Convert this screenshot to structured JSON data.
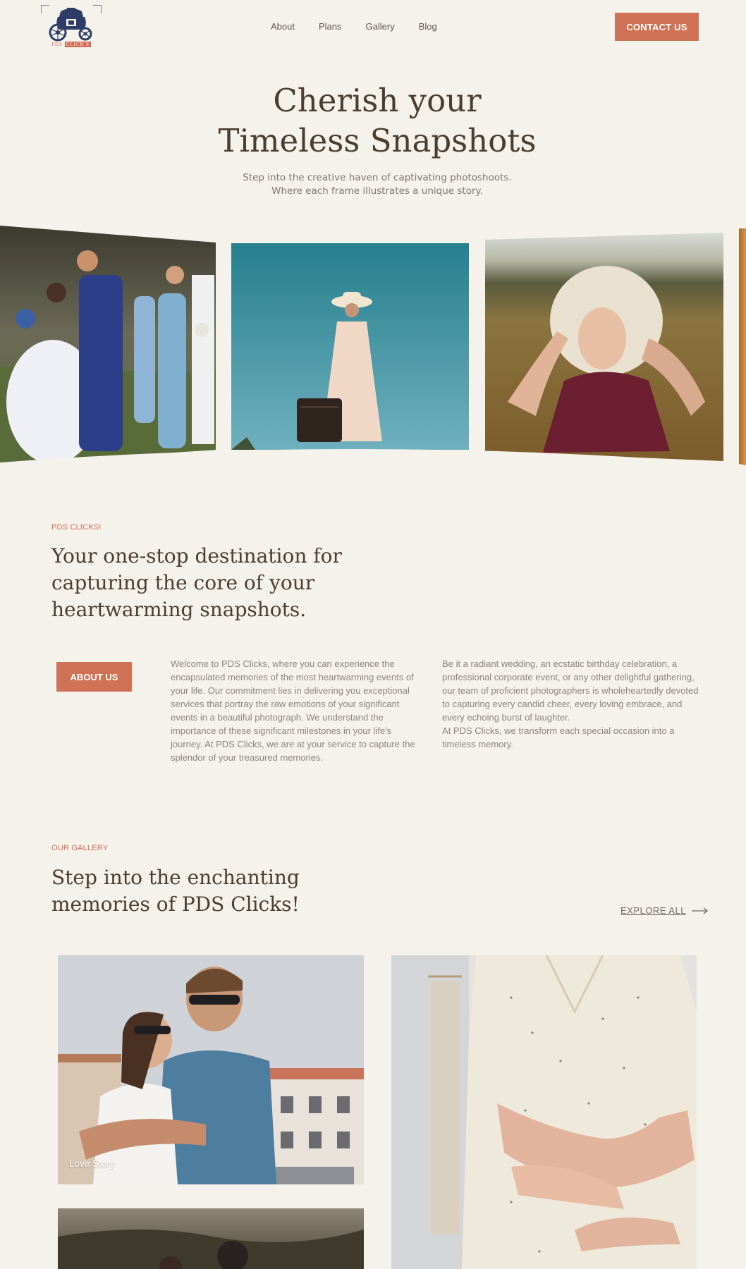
{
  "brand": {
    "logo_pds": "PDS",
    "logo_clicks": "CLICK'S",
    "accent": "#d07256",
    "background": "#f5f2ec"
  },
  "nav": {
    "items": [
      {
        "label": "About"
      },
      {
        "label": "Plans"
      },
      {
        "label": "Gallery"
      },
      {
        "label": "Blog"
      }
    ],
    "contact_label": "CONTACT US"
  },
  "hero": {
    "title_line1": "Cherish your",
    "title_line2": "Timeless Snapshots",
    "subtitle": "Step into the creative haven of captivating photoshoots. Where each frame illustrates a unique story."
  },
  "about": {
    "eyebrow": "PDS CLICKS!",
    "title": "Your one-stop destination for capturing the core of your heartwarming snapshots.",
    "button_label": "ABOUT US",
    "paragraph1": "Welcome to PDS Clicks, where you can experience the encapsulated memories of the most heartwarming events of your life. Our commitment lies in delivering you exceptional services that portray the raw emotions of your significant events in a beautiful photograph. We understand the importance of these significant milestones in your life's journey. At PDS Clicks, we are at your service to capture the splendor of your treasured memories.",
    "paragraph2a": "Be it a radiant wedding, an ecstatic birthday celebration, a professional corporate event, or any other delightful gathering, our team of proficient photographers is wholeheartedly devoted to capturing every candid cheer, every loving embrace, and every echoing burst of laughter.",
    "paragraph2b": "At PDS Clicks, we transform each special occasion into a timeless memory."
  },
  "gallery": {
    "eyebrow": "OUR GALLERY",
    "title": "Step into the enchanting memories of PDS Clicks!",
    "explore_label": "EXPLORE ALL",
    "cards": [
      {
        "label": "Love Story"
      }
    ]
  },
  "icons": {
    "logo": "carriage-icon",
    "explore": "arrow-right-icon"
  }
}
